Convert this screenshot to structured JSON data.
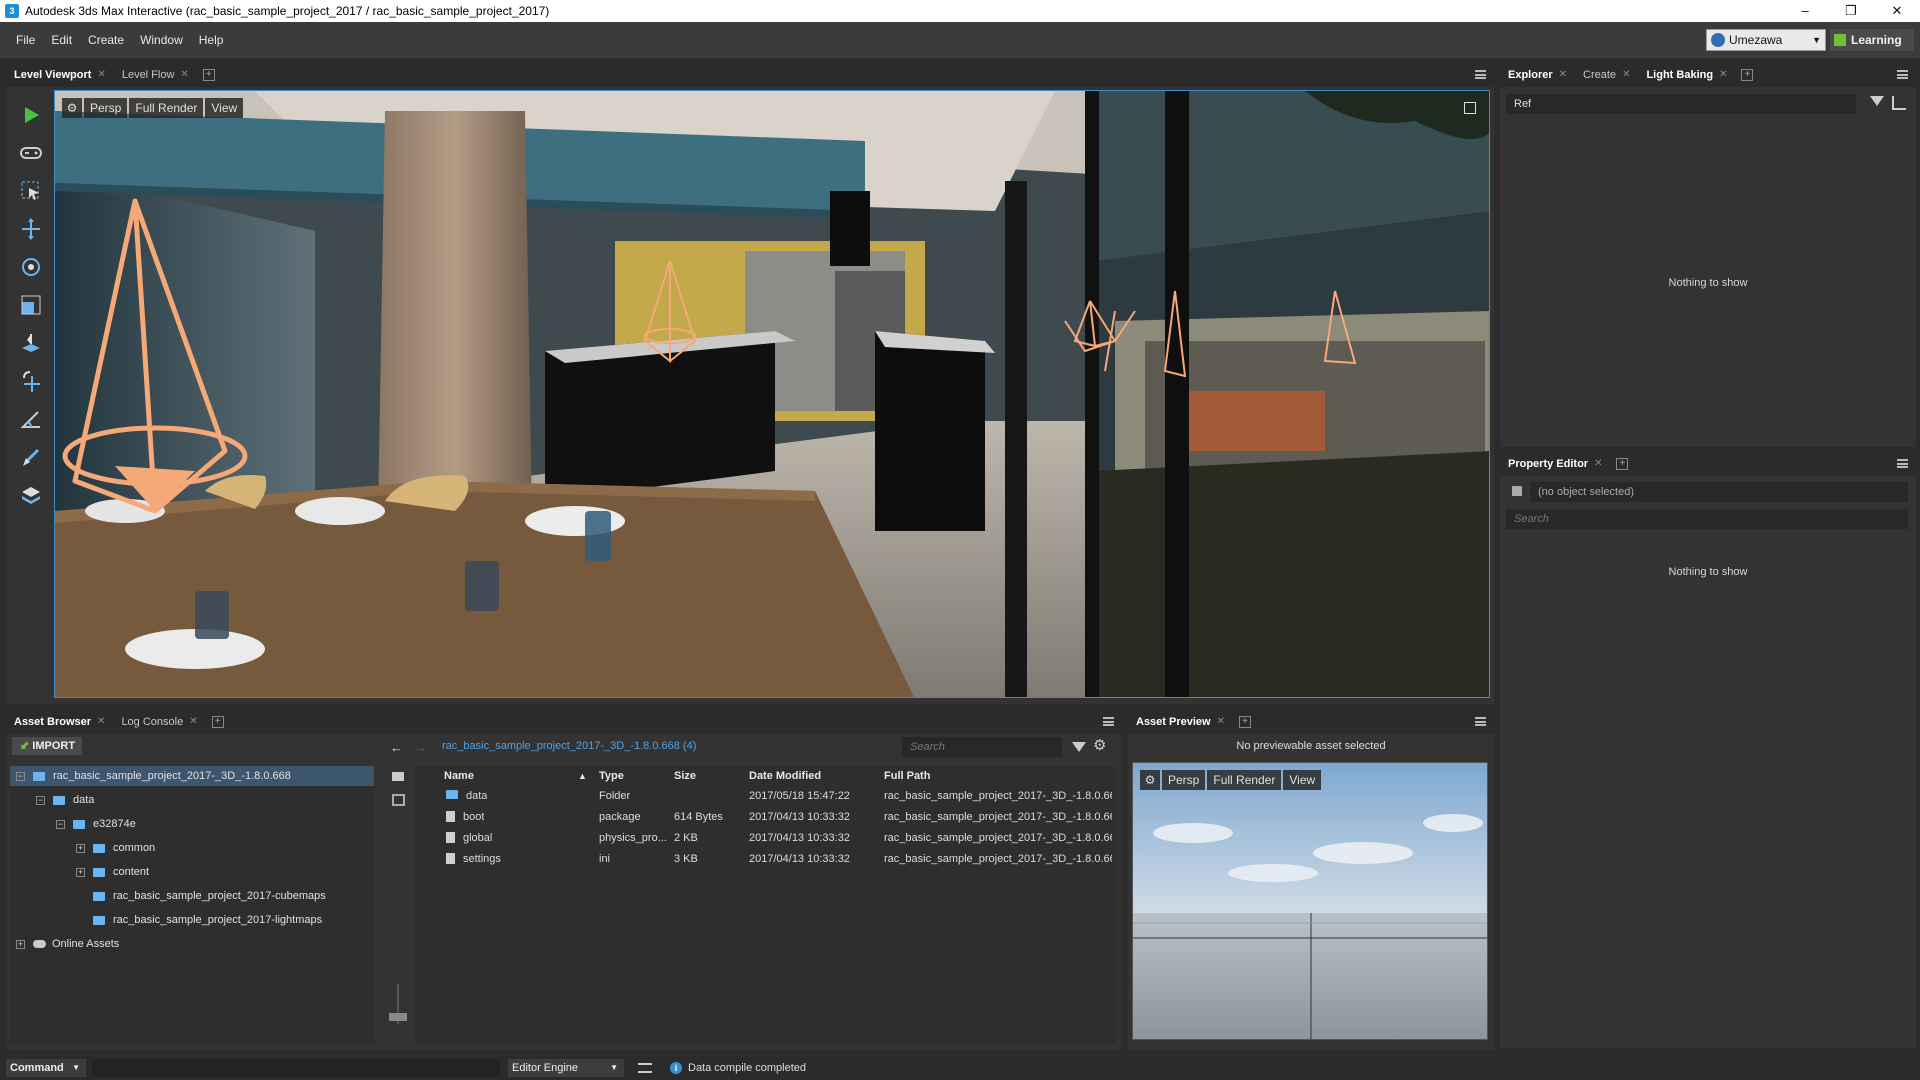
{
  "window": {
    "title": "Autodesk 3ds Max Interactive (rac_basic_sample_project_2017 / rac_basic_sample_project_2017)",
    "app_icon": "3",
    "min": "–",
    "restore": "❐",
    "close": "✕"
  },
  "menu": [
    "File",
    "Edit",
    "Create",
    "Window",
    "Help"
  ],
  "user": {
    "name": "Umezawa",
    "learning": "Learning"
  },
  "viewport_panel": {
    "tabs": [
      {
        "label": "Level Viewport",
        "active": true
      },
      {
        "label": "Level Flow",
        "active": false
      }
    ],
    "toolbar": {
      "camera": "Persp",
      "render": "Full Render",
      "view": "View"
    }
  },
  "explorer_panel": {
    "tabs": [
      {
        "label": "Explorer",
        "active": true
      },
      {
        "label": "Create",
        "active": false
      },
      {
        "label": "Light Baking",
        "active": false
      }
    ],
    "filter_value": "Ref",
    "empty": "Nothing to show"
  },
  "property_panel": {
    "tab": "Property Editor",
    "object": "(no object selected)",
    "search_placeholder": "Search",
    "empty": "Nothing to show"
  },
  "asset_browser": {
    "tabs": [
      {
        "label": "Asset Browser",
        "active": true
      },
      {
        "label": "Log Console",
        "active": false
      }
    ],
    "import_label": "IMPORT",
    "breadcrumb": "rac_basic_sample_project_2017-_3D_-1.8.0.668 (4)",
    "search_placeholder": "Search",
    "tree": [
      {
        "label": "rac_basic_sample_project_2017-_3D_-1.8.0.668",
        "level": 0,
        "expander": "−",
        "selected": true
      },
      {
        "label": "data",
        "level": 1,
        "expander": "−"
      },
      {
        "label": "e32874e",
        "level": 2,
        "expander": "−"
      },
      {
        "label": "common",
        "level": 3,
        "expander": "+"
      },
      {
        "label": "content",
        "level": 3,
        "expander": "+"
      },
      {
        "label": "rac_basic_sample_project_2017-cubemaps",
        "level": 3,
        "expander": ""
      },
      {
        "label": "rac_basic_sample_project_2017-lightmaps",
        "level": 3,
        "expander": ""
      },
      {
        "label": "Online Assets",
        "level": 0,
        "expander": "+",
        "cloud": true
      }
    ],
    "columns": {
      "name": "Name",
      "type": "Type",
      "size": "Size",
      "modified": "Date Modified",
      "path": "Full Path",
      "sort_arrow": "▲"
    },
    "files": [
      {
        "name": "data",
        "type": "Folder",
        "size": "",
        "modified": "2017/05/18 15:47:22",
        "path": "rac_basic_sample_project_2017-_3D_-1.8.0.66...",
        "folder": true
      },
      {
        "name": "boot",
        "type": "package",
        "size": "614 Bytes",
        "modified": "2017/04/13 10:33:32",
        "path": "rac_basic_sample_project_2017-_3D_-1.8.0.66..."
      },
      {
        "name": "global",
        "type": "physics_pro...",
        "size": "2 KB",
        "modified": "2017/04/13 10:33:32",
        "path": "rac_basic_sample_project_2017-_3D_-1.8.0.66..."
      },
      {
        "name": "settings",
        "type": "ini",
        "size": "3 KB",
        "modified": "2017/04/13 10:33:32",
        "path": "rac_basic_sample_project_2017-_3D_-1.8.0.66..."
      }
    ]
  },
  "asset_preview": {
    "tab": "Asset Preview",
    "message": "No previewable asset selected",
    "toolbar": {
      "camera": "Persp",
      "render": "Full Render",
      "view": "View"
    }
  },
  "statusbar": {
    "command_label": "Command",
    "engine": "Editor Engine",
    "status": "Data compile completed"
  },
  "colors": {
    "accent": "#3a8fd0",
    "light_gizmo": "#f5a878",
    "play": "#44c244"
  }
}
